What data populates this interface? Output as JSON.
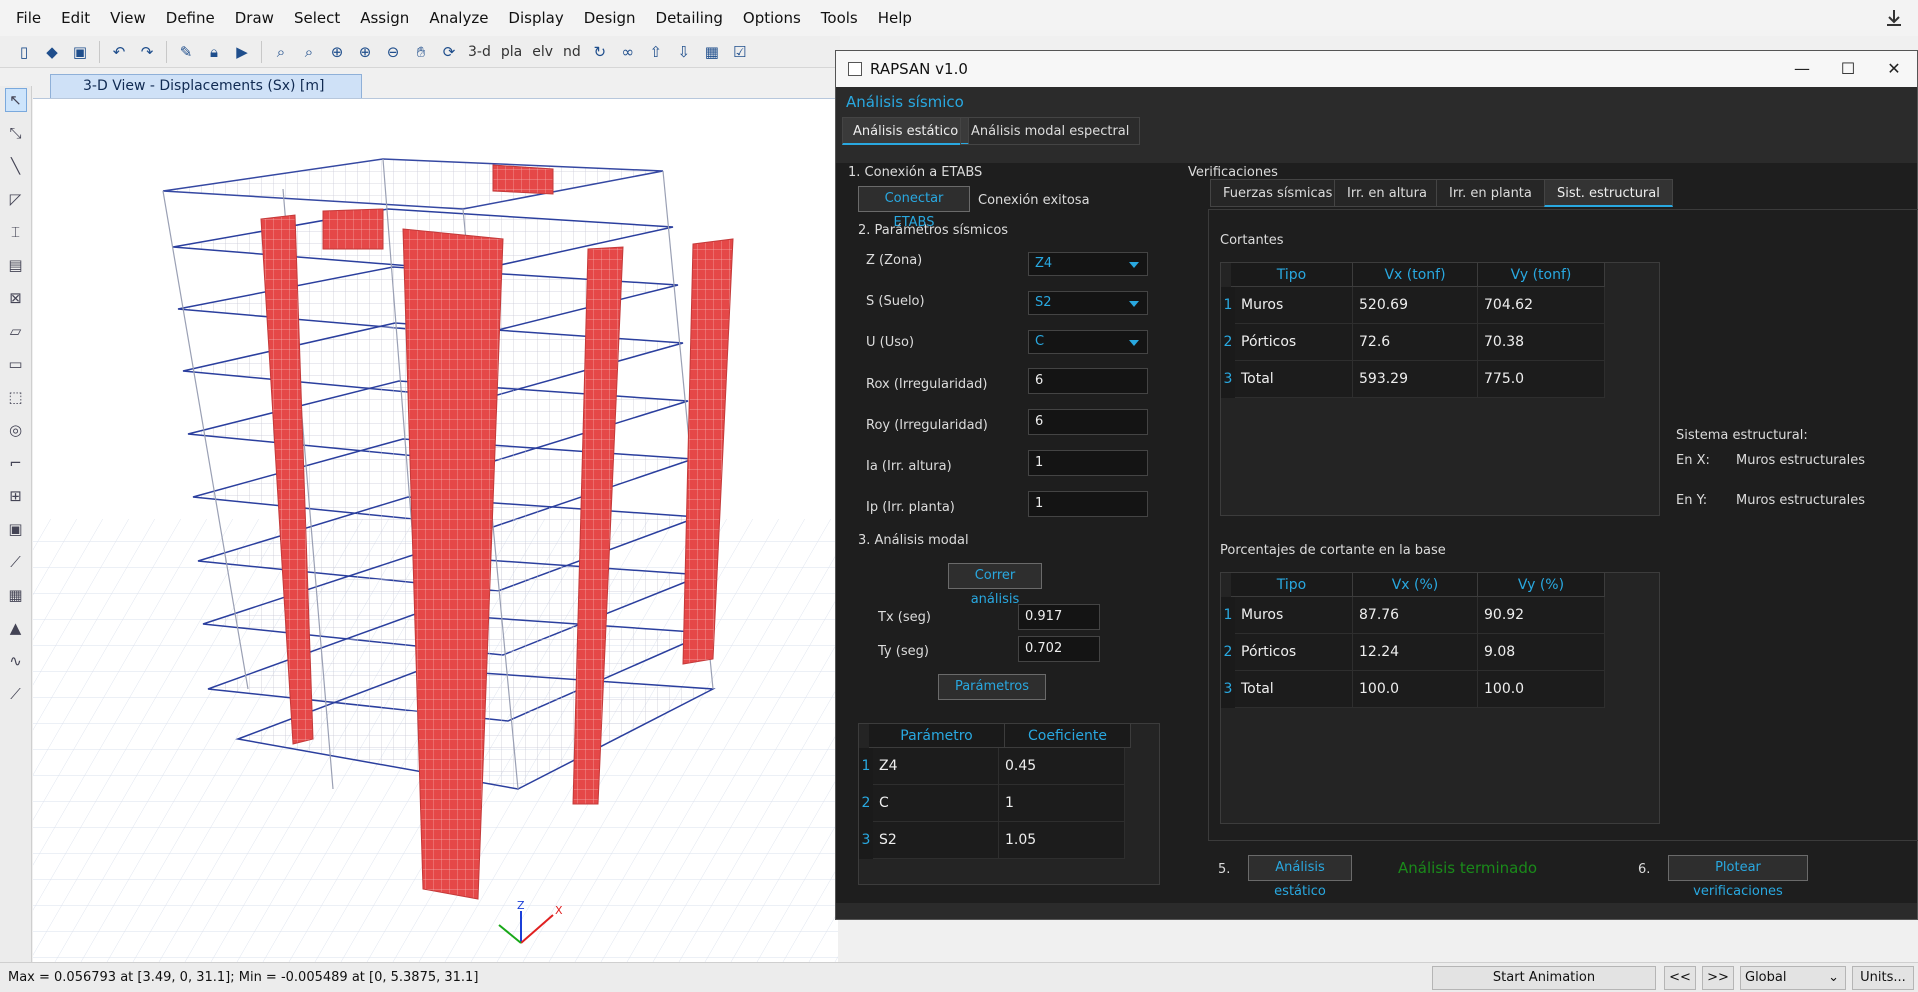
{
  "etabs": {
    "menu": [
      "File",
      "Edit",
      "View",
      "Define",
      "Draw",
      "Select",
      "Assign",
      "Analyze",
      "Display",
      "Design",
      "Detailing",
      "Options",
      "Tools",
      "Help"
    ],
    "view_tab": "3-D View  - Displacements (Sx)  [m]",
    "toolbar_text": {
      "three_d": "3-d",
      "pla": "pla",
      "elev": "elv",
      "nd": "nd"
    },
    "status": "Max = 0.056793 at [3.49, 0, 31.1];  Min = -0.005489 at [0, 5.3875, 31.1]",
    "start_animation": "Start Animation",
    "prev": "<<",
    "next": ">>",
    "coord_system": "Global",
    "units": "Units...",
    "axis_labels": {
      "x": "X",
      "z": "Z"
    }
  },
  "rapsan": {
    "title": "RAPSAN v1.0",
    "header": "Análisis sísmico",
    "tabs": [
      "Análisis estático",
      "Análisis modal espectral"
    ],
    "section1": "1. Conexión a ETABS",
    "connect_button": "Conectar ETABS",
    "connect_status": "Conexión exitosa",
    "section2": "2. Parámetros sísmicos",
    "params": [
      {
        "label": "Z (Zona)",
        "value": "Z4"
      },
      {
        "label": "S (Suelo)",
        "value": "S2"
      },
      {
        "label": "U (Uso)",
        "value": "C"
      }
    ],
    "fields": [
      {
        "label": "Rox (Irregularidad)",
        "value": "6"
      },
      {
        "label": "Roy (Irregularidad)",
        "value": "6"
      },
      {
        "label": "Ia (Irr. altura)",
        "value": "1"
      },
      {
        "label": "Ip (Irr. planta)",
        "value": "1"
      }
    ],
    "section3": "3. Análisis modal",
    "run_button": "Correr análisis",
    "tx_label": "Tx (seg)",
    "tx_value": "0.917",
    "ty_label": "Ty (seg)",
    "ty_value": "0.702",
    "params_button": "Parámetros",
    "param_table": {
      "headers": [
        "Parámetro",
        "Coeficiente"
      ],
      "rows": [
        [
          "1",
          "Z4",
          "0.45"
        ],
        [
          "2",
          "C",
          "1"
        ],
        [
          "3",
          "S2",
          "1.05"
        ]
      ]
    },
    "verificaciones": "Verificaciones",
    "vtabs": [
      "Fuerzas sísmicas",
      "Irr. en altura",
      "Irr. en planta",
      "Sist. estructural"
    ],
    "cortantes_label": "Cortantes",
    "cortantes": {
      "headers": [
        "Tipo",
        "Vx (tonf)",
        "Vy (tonf)"
      ],
      "rows": [
        [
          "1",
          "Muros",
          "520.69",
          "704.62"
        ],
        [
          "2",
          "Pórticos",
          "72.6",
          "70.38"
        ],
        [
          "3",
          "Total",
          "593.29",
          "775.0"
        ]
      ]
    },
    "porcentajes_label": "Porcentajes de cortante en la base",
    "porcentajes": {
      "headers": [
        "Tipo",
        "Vx (%)",
        "Vy (%)"
      ],
      "rows": [
        [
          "1",
          "Muros",
          "87.76",
          "90.92"
        ],
        [
          "2",
          "Pórticos",
          "12.24",
          "9.08"
        ],
        [
          "3",
          "Total",
          "100.0",
          "100.0"
        ]
      ]
    },
    "sistema_label": "Sistema estructural:",
    "en_x_label": "En X:",
    "en_x_value": "Muros estructurales",
    "en_y_label": "En Y:",
    "en_y_value": "Muros estructurales",
    "step5": "5.",
    "static_button": "Análisis estático",
    "done_status": "Análisis terminado",
    "step6": "6.",
    "plot_button": "Plotear verificaciones",
    "colors": {
      "accent": "#29a8e0",
      "ok": "#1a8a1a",
      "wall": "#e54848",
      "frame": "#2b3f9e"
    }
  }
}
